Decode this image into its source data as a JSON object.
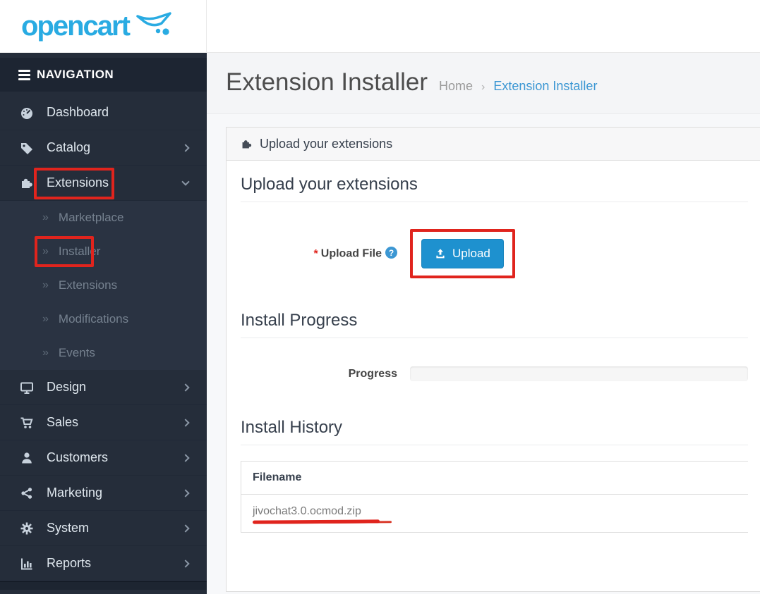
{
  "brand": {
    "logo_text": "opencart"
  },
  "colors": {
    "accent_blue": "#1e91cf",
    "link_blue": "#3c97d3",
    "annotation_red": "#e0241d",
    "sidebar_bg": "#252d3a"
  },
  "sidebar": {
    "header": {
      "label": "NAVIGATION"
    },
    "submenu_prefix": "»",
    "items": [
      {
        "label": "Dashboard",
        "icon": "dashboard-icon"
      },
      {
        "label": "Catalog",
        "icon": "tags-icon"
      },
      {
        "label": "Extensions",
        "icon": "puzzle-icon",
        "expanded": true
      },
      {
        "label": "Design",
        "icon": "monitor-icon"
      },
      {
        "label": "Sales",
        "icon": "cart-icon"
      },
      {
        "label": "Customers",
        "icon": "user-icon"
      },
      {
        "label": "Marketing",
        "icon": "share-icon"
      },
      {
        "label": "System",
        "icon": "gear-icon"
      },
      {
        "label": "Reports",
        "icon": "bar-chart-icon"
      }
    ],
    "submenu": [
      {
        "label": "Marketplace"
      },
      {
        "label": "Installer",
        "annotated": true
      },
      {
        "label": "Extensions"
      },
      {
        "label": "Modifications"
      },
      {
        "label": "Events"
      }
    ]
  },
  "page": {
    "title": "Extension Installer",
    "breadcrumb": {
      "home": "Home",
      "separator": "›",
      "current": "Extension Installer"
    }
  },
  "panel": {
    "header_title": "Upload your extensions"
  },
  "upload_section": {
    "heading": "Upload your extensions",
    "required_marker": "*",
    "field_label": "Upload File",
    "help_glyph": "?",
    "button_label": "Upload"
  },
  "progress_section": {
    "heading": "Install Progress",
    "label": "Progress",
    "progress_percent": 0
  },
  "history_section": {
    "heading": "Install History",
    "columns": [
      "Filename"
    ],
    "rows": [
      [
        "jivochat3.0.ocmod.zip"
      ]
    ]
  }
}
